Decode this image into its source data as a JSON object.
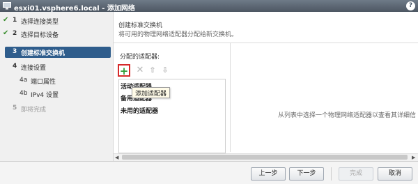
{
  "window": {
    "title": "esxi01.vsphere6.local - 添加网络",
    "help_label": "?"
  },
  "nav": {
    "items": [
      {
        "num": "1",
        "label": "选择连接类型",
        "state": "done"
      },
      {
        "num": "2",
        "label": "选择目标设备",
        "state": "done"
      },
      {
        "num": "3",
        "label": "创建标准交换机",
        "state": "active"
      },
      {
        "num": "4",
        "label": "连接设置",
        "state": "pending"
      },
      {
        "num": "4a",
        "label": "端口属性",
        "state": "pending"
      },
      {
        "num": "4b",
        "label": "IPv4 设置",
        "state": "pending"
      },
      {
        "num": "5",
        "label": "即将完成",
        "state": "disabled"
      }
    ]
  },
  "main": {
    "header_title": "创建标准交换机",
    "header_desc": "将可用的物理网络适配器分配给新交换机。",
    "section_label": "分配的适配器:",
    "groups": [
      "活动适配器",
      "备用适配器",
      "未用的适配器"
    ],
    "tooltip": "添加适配器",
    "details_hint": "从列表中选择一个物理网络适配器以查看其详细信"
  },
  "toolbar": {
    "add_icon": "+",
    "remove_icon": "✕",
    "up_icon": "⇧",
    "down_icon": "⇩"
  },
  "footer": {
    "prev": "上一步",
    "next": "下一步",
    "finish": "完成",
    "cancel": "取消"
  },
  "colors": {
    "accent": "#2f5d8c",
    "check": "#3a8e2e",
    "add_border": "#d62a2a"
  }
}
